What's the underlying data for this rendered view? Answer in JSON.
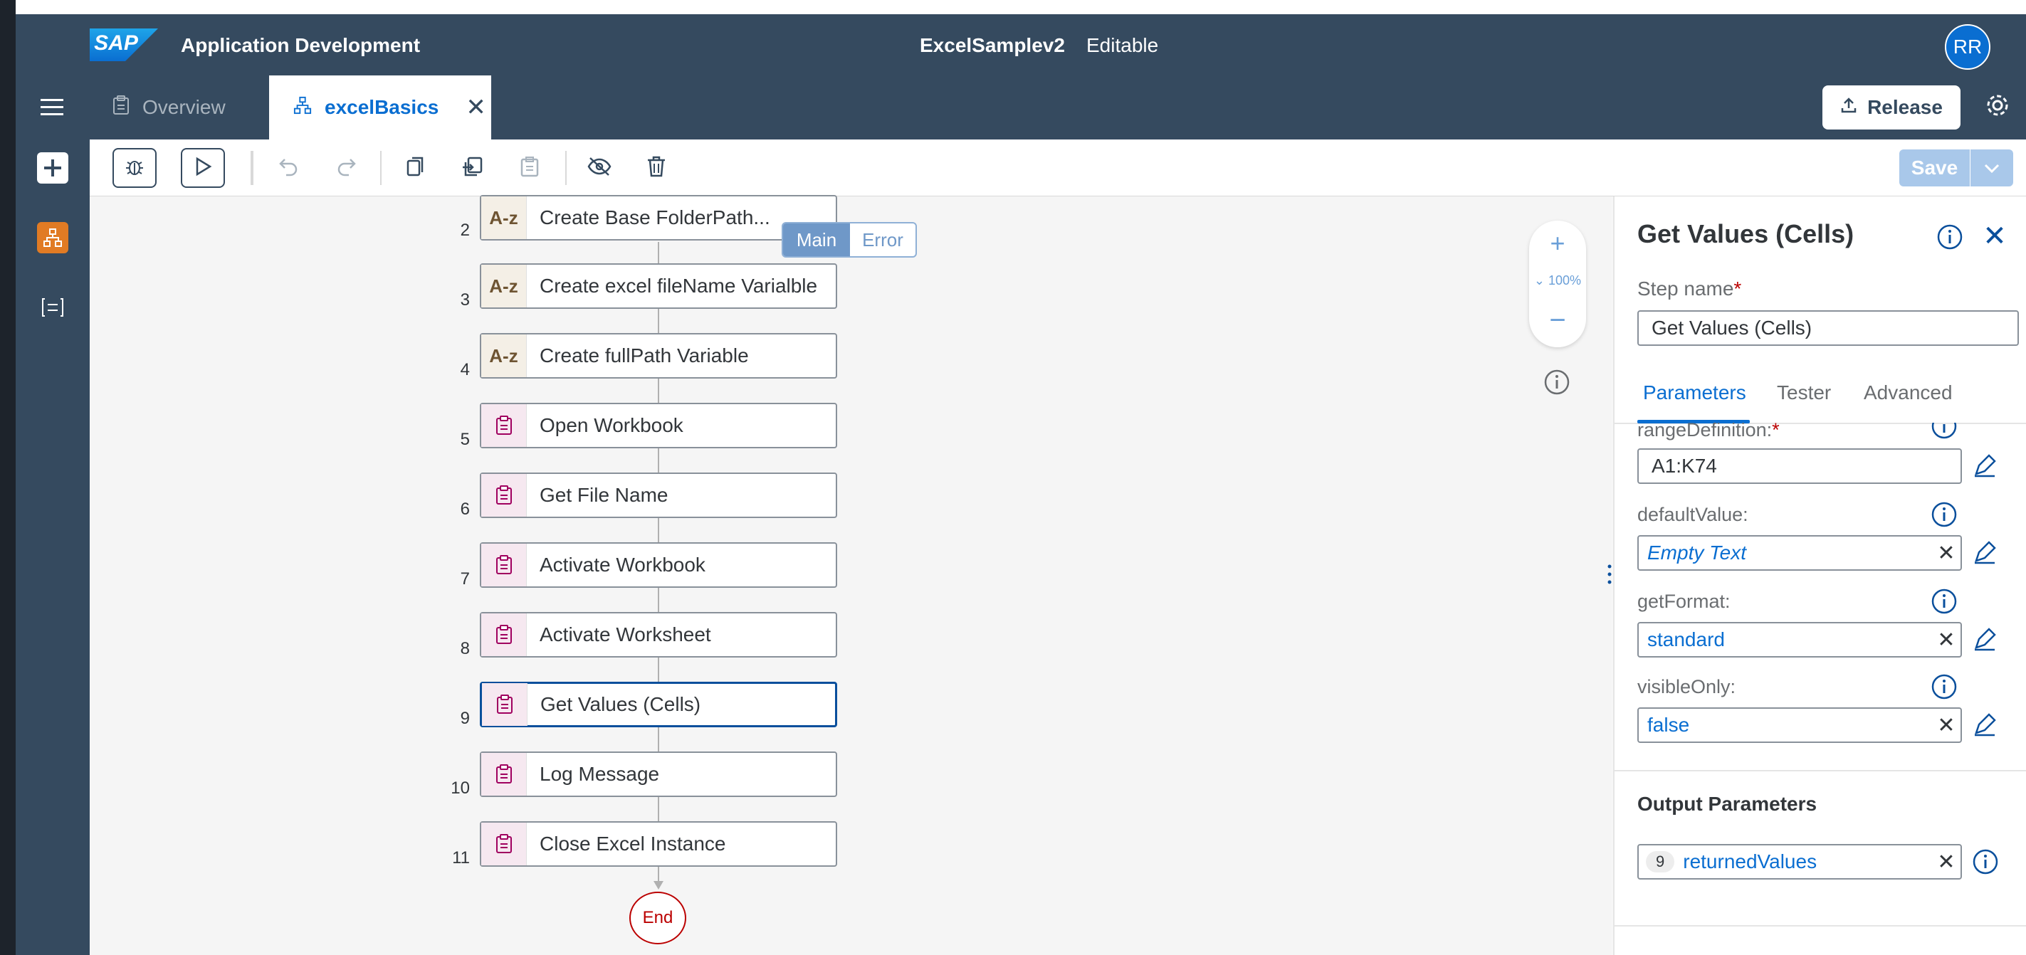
{
  "header": {
    "logo_text": "SAP",
    "app_title": "Application Development",
    "project_name": "ExcelSamplev2",
    "project_status": "Editable",
    "avatar_initials": "RR",
    "release_label": "Release"
  },
  "tabs": [
    {
      "label": "Overview",
      "icon": "clipboard-icon"
    },
    {
      "label": "excelBasics",
      "icon": "process-icon"
    }
  ],
  "toolbar": {
    "save_label": "Save",
    "items": [
      "debug-icon",
      "run-icon",
      "undo-icon",
      "redo-icon",
      "copy-icon",
      "duplicate-icon",
      "paste-icon",
      "hide-icon",
      "delete-icon"
    ]
  },
  "flow": {
    "branch_main": "Main",
    "branch_error": "Error",
    "steps": [
      {
        "num": "2",
        "label": "Create Base FolderPath...",
        "type": "variable",
        "icon_text": "A-z"
      },
      {
        "num": "3",
        "label": "Create excel fileName Varialble",
        "type": "variable",
        "icon_text": "A-z"
      },
      {
        "num": "4",
        "label": "Create fullPath Variable",
        "type": "variable",
        "icon_text": "A-z"
      },
      {
        "num": "5",
        "label": "Open Workbook",
        "type": "activity",
        "icon_text": ""
      },
      {
        "num": "6",
        "label": "Get File Name",
        "type": "activity",
        "icon_text": ""
      },
      {
        "num": "7",
        "label": "Activate Workbook",
        "type": "activity",
        "icon_text": ""
      },
      {
        "num": "8",
        "label": "Activate Worksheet",
        "type": "activity",
        "icon_text": ""
      },
      {
        "num": "9",
        "label": "Get Values (Cells)",
        "type": "activity",
        "icon_text": "",
        "selected": true
      },
      {
        "num": "10",
        "label": "Log Message",
        "type": "activity",
        "icon_text": ""
      },
      {
        "num": "11",
        "label": "Close Excel Instance",
        "type": "activity",
        "icon_text": ""
      }
    ],
    "end_label": "End",
    "zoom_level": "100%"
  },
  "panel": {
    "title": "Get Values (Cells)",
    "step_name_label": "Step name",
    "required_mark": "*",
    "step_name_value": "Get Values (Cells)",
    "tabs": [
      "Parameters",
      "Tester",
      "Advanced"
    ],
    "fields": [
      {
        "label": "rangeDefinition:",
        "required": "*",
        "value": "A1:K74",
        "style": "plain"
      },
      {
        "label": "defaultValue:",
        "value": "Empty Text",
        "style": "italic"
      },
      {
        "label": "getFormat:",
        "value": "standard",
        "style": "link"
      },
      {
        "label": "visibleOnly:",
        "value": "false",
        "style": "link"
      }
    ],
    "output_title": "Output Parameters",
    "output": {
      "badge": "9",
      "value": "returnedValues"
    }
  },
  "colors": {
    "shell": "#354a5f",
    "accent": "#0a6ed1",
    "avatar": "#0a6ed1",
    "end_node": "#bb0000"
  }
}
